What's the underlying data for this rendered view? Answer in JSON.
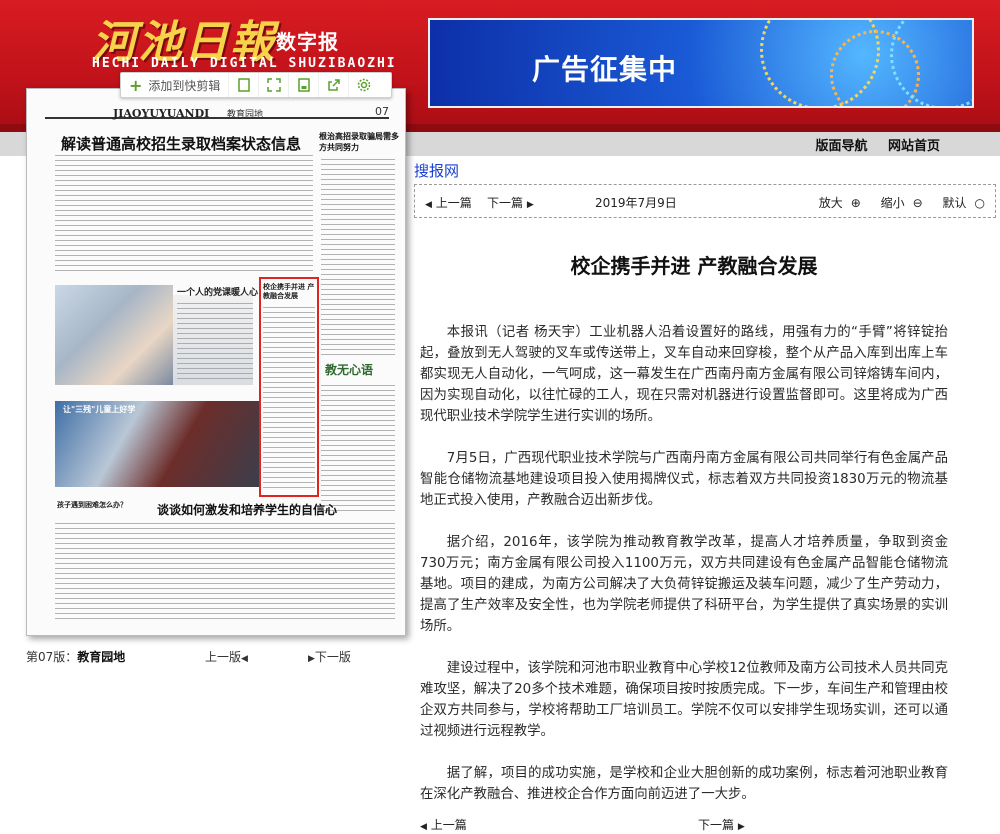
{
  "header": {
    "logo_main": "河池日報",
    "logo_sub": "数字报",
    "logo_en": "HECHI DAILY DIGITAL SHUZIBAOZHI",
    "ad_text": "广告征集中"
  },
  "nav": {
    "layout_nav": "版面导航",
    "home": "网站首页"
  },
  "toolbar": {
    "add_label": "添加到快剪辑",
    "icons": [
      "page-icon",
      "expand-icon",
      "save-icon",
      "share-icon",
      "settings-icon"
    ]
  },
  "paper": {
    "pinyin": "JIAOYUYUANDI",
    "section": "教育园地",
    "page_no": "07",
    "headline": "解读普通高校招生录取档案状态信息",
    "side_headline": "根治高招录取骗局需多方共同努力",
    "photo_caption1": "一个人的党课暖人心",
    "photo_caption2": "让\"三残\"儿童上好学",
    "highlight_title": "校企携手并进 产教融合发展",
    "calligraphy": "教无心语",
    "side2": "孩子遇到困难怎么办？",
    "headline2": "谈谈如何激发和培养学生的自信心"
  },
  "page_nav": {
    "label_prefix": "第07版：",
    "label_name": "教育园地",
    "prev": "上一版",
    "next": "下一版"
  },
  "article_nav": {
    "search": "搜报网",
    "prev": "上一篇",
    "next": "下一篇",
    "date": "2019年7月9日",
    "zoom_in": "放大",
    "zoom_out": "缩小",
    "default": "默认"
  },
  "article": {
    "title": "校企携手并进 产教融合发展",
    "paragraphs": [
      "本报讯（记者 杨天宇）工业机器人沿着设置好的路线，用强有力的“手臂”将锌锭抬起，叠放到无人驾驶的叉车或传送带上，叉车自动来回穿梭，整个从产品入库到出库上车都实现无人自动化，一气呵成，这一幕发生在广西南丹南方金属有限公司锌熔铸车间内，因为实现自动化，以往忙碌的工人，现在只需对机器进行设置监督即可。这里将成为广西现代职业技术学院学生进行实训的场所。",
      "7月5日，广西现代职业技术学院与广西南丹南方金属有限公司共同举行有色金属产品智能仓储物流基地建设项目投入使用揭牌仪式，标志着双方共同投资1830万元的物流基地正式投入使用，产教融合迈出新步伐。",
      "据介绍，2016年，该学院为推动教育教学改革，提高人才培养质量，争取到资金730万元；南方金属有限公司投入1100万元，双方共同建设有色金属产品智能仓储物流基地。项目的建成，为南方公司解决了大负荷锌锭搬运及装车问题，减少了生产劳动力，提高了生产效率及安全性，也为学院老师提供了科研平台，为学生提供了真实场景的实训场所。",
      "建设过程中，该学院和河池市职业教育中心学校12位教师及南方公司技术人员共同克难攻坚，解决了20多个技术难题，确保项目按时按质完成。下一步，车间生产和管理由校企双方共同参与，学校将帮助工厂培训员工。学院不仅可以安排学生现场实训，还可以通过视频进行远程教学。",
      "据了解，项目的成功实施，是学校和企业大胆创新的成功案例，标志着河池职业教育在深化产教融合、推进校企合作方面向前迈进了一大步。"
    ]
  },
  "bottom_nav": {
    "prev": "上一篇",
    "next": "下一篇"
  },
  "colors": {
    "header_red": "#c1121a",
    "logo_gold": "#f6d34a",
    "link_blue": "#1a3fd1",
    "highlight_red": "#e0241f"
  }
}
